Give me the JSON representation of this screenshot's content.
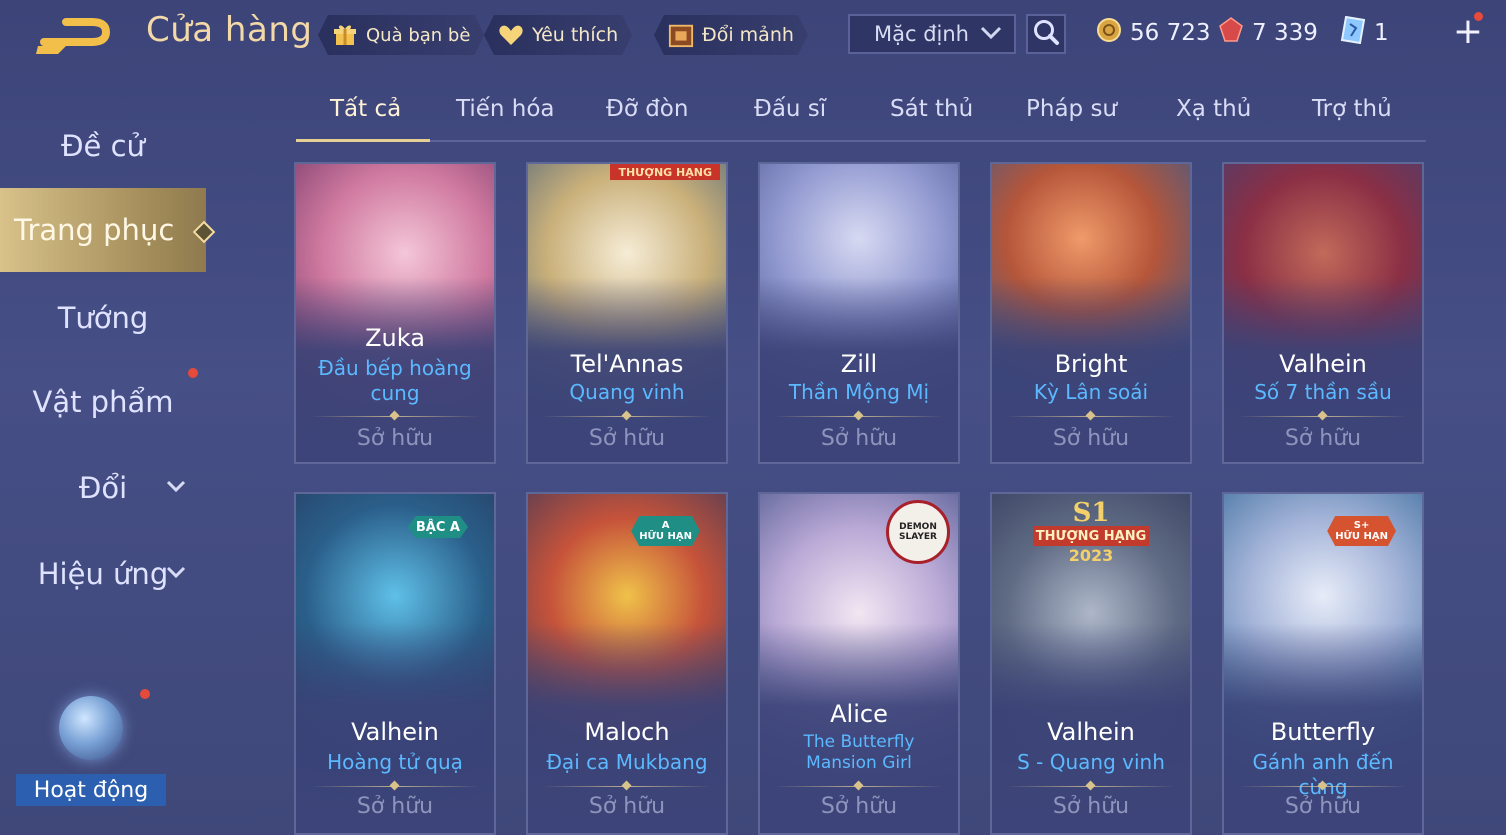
{
  "header": {
    "title": "Cửa hàng",
    "buttons": [
      {
        "label": "Quà bạn bè",
        "icon": "gift-icon"
      },
      {
        "label": "Yêu thích",
        "icon": "heart-icon"
      },
      {
        "label": "Đổi mảnh",
        "icon": "chest-icon"
      }
    ],
    "sort_value": "Mặc định",
    "currencies": [
      {
        "name": "gold",
        "value": "56 723",
        "icon": "gold-coin-icon"
      },
      {
        "name": "voucher",
        "value": "7 339",
        "icon": "red-gem-icon"
      },
      {
        "name": "card",
        "value": "1",
        "icon": "blue-card-icon"
      }
    ]
  },
  "sidebar": {
    "items": [
      {
        "label": "Đề cử"
      },
      {
        "label": "Trang phục"
      },
      {
        "label": "Tướng"
      },
      {
        "label": "Vật phẩm"
      },
      {
        "label": "Đổi"
      },
      {
        "label": "Hiệu ứng"
      }
    ],
    "activity_label": "Hoạt động"
  },
  "tabs": [
    "Tất cả",
    "Tiến hóa",
    "Đỡ đòn",
    "Đấu sĩ",
    "Sát thủ",
    "Pháp sư",
    "Xạ thủ",
    "Trợ thủ"
  ],
  "cards": [
    {
      "hero": "Zuka",
      "skin": "Đầu bếp hoàng cung",
      "status": "Sở hữu"
    },
    {
      "hero": "Tel'Annas",
      "skin": "Quang vinh",
      "status": "Sở hữu",
      "ribbon": "THƯỢNG HẠNG"
    },
    {
      "hero": "Zill",
      "skin": "Thần Mộng Mị",
      "status": "Sở hữu"
    },
    {
      "hero": "Bright",
      "skin": "Kỳ Lân soái",
      "status": "Sở hữu"
    },
    {
      "hero": "Valhein",
      "skin": "Số 7 thần sầu",
      "status": "Sở hữu"
    },
    {
      "hero": "Valhein",
      "skin": "Hoàng tử quạ",
      "status": "Sở hữu",
      "badge": "BẬC A"
    },
    {
      "hero": "Maloch",
      "skin": "Đại ca Mukbang",
      "status": "Sở hữu",
      "badge_top": "A",
      "badge": "HỮU HẠN"
    },
    {
      "hero": "Alice",
      "skin": "The Butterfly Mansion Girl",
      "status": "Sở hữu",
      "logo": "DEMON SLAYER"
    },
    {
      "hero": "Valhein",
      "skin": "S - Quang vinh",
      "status": "Sở hữu",
      "emblem_top": "S1",
      "emblem_mid": "THƯỢNG HẠNG",
      "emblem_bot": "2023"
    },
    {
      "hero": "Butterfly",
      "skin": "Gánh anh đến cùng",
      "status": "Sở hữu",
      "badge_top": "S+",
      "badge": "HỮU HẠN"
    }
  ]
}
